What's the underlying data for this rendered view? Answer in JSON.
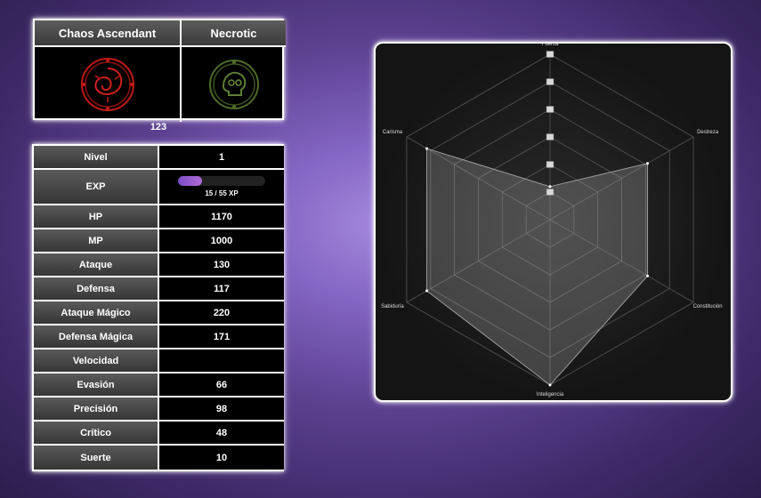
{
  "header": {
    "class_name": "Chaos Ascendant",
    "element_name": "Necrotic",
    "class_icon": "chaos-emblem-icon",
    "element_icon": "necrotic-emblem-icon",
    "id_label": "123"
  },
  "colors": {
    "class_emblem": "#c01818",
    "element_emblem": "#4e6b2a",
    "exp_fill": "#9b5ad1"
  },
  "stats": {
    "level": {
      "label": "Nivel",
      "value": "1"
    },
    "exp": {
      "label": "EXP",
      "text": "15 / 55 XP",
      "current": 15,
      "max": 55
    },
    "rows": [
      {
        "label": "HP",
        "value": "1170"
      },
      {
        "label": "MP",
        "value": "1000"
      },
      {
        "label": "Ataque",
        "value": "130"
      },
      {
        "label": "Defensa",
        "value": "117"
      },
      {
        "label": "Ataque Mágico",
        "value": "220"
      },
      {
        "label": "Defensa Mágica",
        "value": "171"
      },
      {
        "label": "Velocidad",
        "value": ""
      },
      {
        "label": "Evasión",
        "value": "66"
      },
      {
        "label": "Precisión",
        "value": "98"
      },
      {
        "label": "Crítico",
        "value": "48"
      },
      {
        "label": "Suerte",
        "value": "10"
      }
    ]
  },
  "chart_data": {
    "type": "radar",
    "axes": [
      "Fuerza",
      "Destreza",
      "Constitución",
      "Inteligencia",
      "Sabiduría",
      "Carisma"
    ],
    "values": [
      0.2,
      0.68,
      0.68,
      1.0,
      0.86,
      0.86
    ],
    "max": 1,
    "rings": 6,
    "grid": true
  }
}
